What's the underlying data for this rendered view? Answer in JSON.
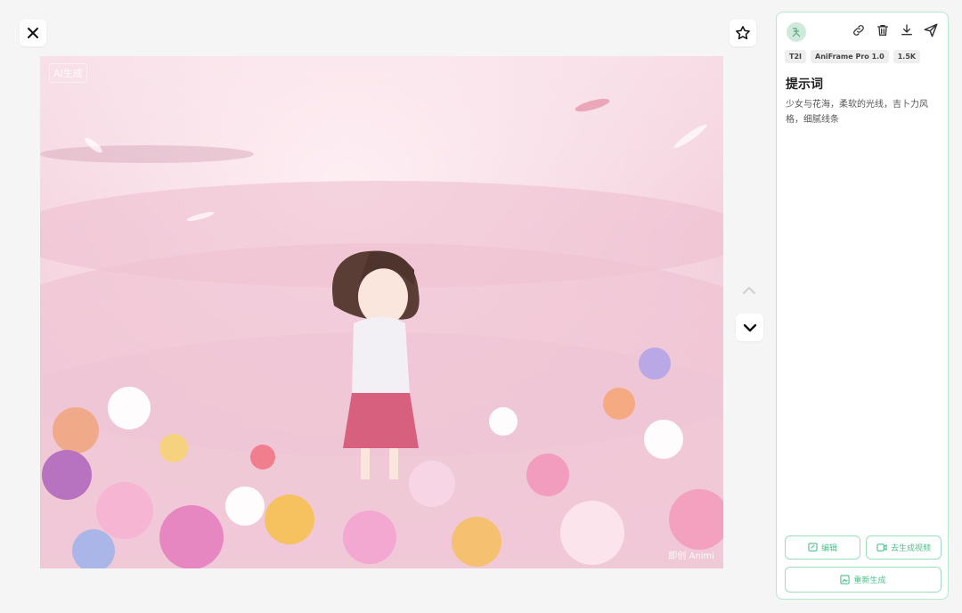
{
  "viewer": {
    "icons": {
      "close": "close-icon",
      "star": "star-icon",
      "up": "chevron-up-icon",
      "down": "chevron-down-icon"
    },
    "image": {
      "badge": "AI生成",
      "watermark": "即创 Animi"
    }
  },
  "panel": {
    "avatar_icon": "avatar-logo-icon",
    "tools": [
      "link-icon",
      "trash-icon",
      "download-icon",
      "send-icon"
    ],
    "tags": [
      "T2I",
      "AniFrame Pro 1.0",
      "1.5K"
    ],
    "prompt_title": "提示词",
    "prompt_text": "少女与花海，柔软的光线，吉卜力风格，细腻线条",
    "buttons": {
      "edit": "编辑",
      "to_video": "去生成视频",
      "regenerate": "重新生成"
    }
  },
  "colors": {
    "accent": "#4cbf8b",
    "border": "#b7e7cf"
  }
}
